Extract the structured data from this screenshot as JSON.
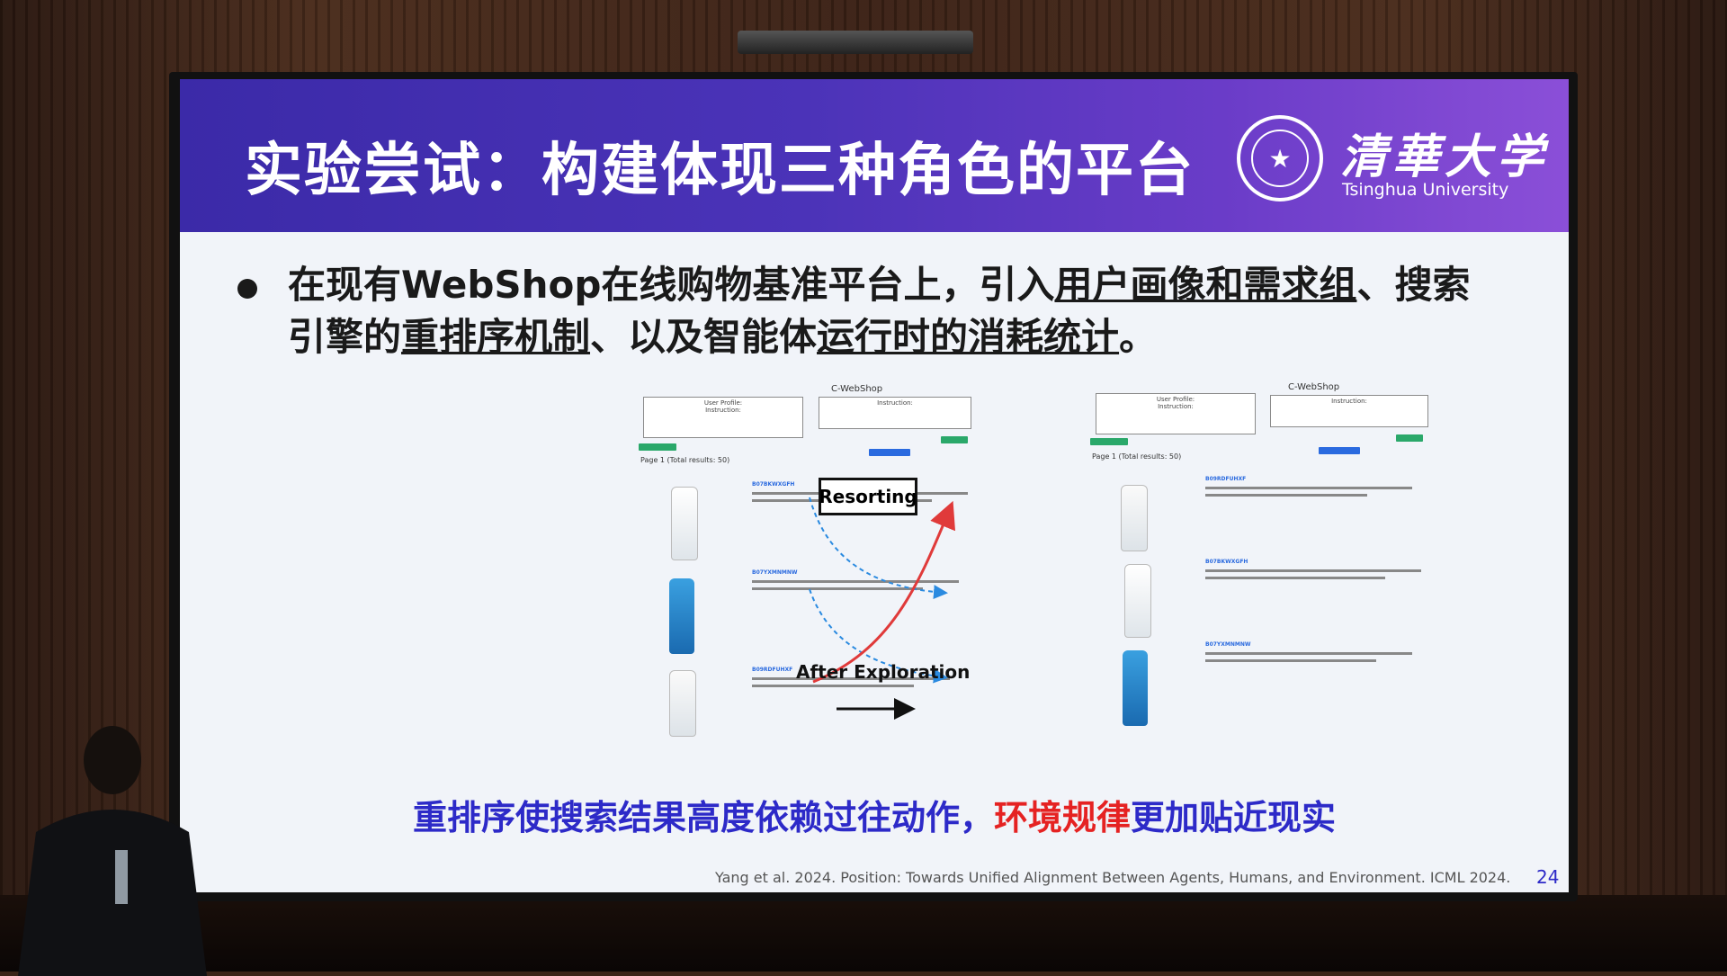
{
  "slide": {
    "title": "实验尝试：构建体现三种角色的平台",
    "logo": {
      "cn": "清華大学",
      "en": "Tsinghua University"
    },
    "bullet": {
      "part1": "在现有WebShop在线购物基准平台上，引入",
      "u1": "用户画像和需求组",
      "part2": "、搜索引擎的",
      "u2": "重排序机制",
      "part3": "、以及智能体",
      "u3": "运行时的消耗统计",
      "part4": "。"
    },
    "figure": {
      "left_title": "C-WebShop",
      "right_title": "C-WebShop",
      "left_page": "Page 1 (Total results: 50)",
      "right_page": "Page 1 (Total results: 50)",
      "resorting": "Resorting",
      "after_exploration": "After Exploration",
      "codes_left": [
        "B07BKWXGFH",
        "B07YXMNMNW",
        "B09RDFUHXF"
      ],
      "codes_right": [
        "B09RDFUHXF",
        "B07BKWXGFH",
        "B07YXMNMNW"
      ],
      "profile_heading": "User Profile:",
      "instruction_heading": "Instruction:"
    },
    "conclusion": {
      "blue1": "重排序使搜索结果高度依赖过往动作，",
      "red": "环境规律",
      "blue2": "更加贴近现实"
    },
    "citation": "Yang et al. 2024. Position: Towards Unified Alignment Between Agents, Humans, and Environment. ICML 2024.",
    "page_number": "24"
  },
  "colors": {
    "title_bar_start": "#3b2aa8",
    "title_bar_end": "#8b4fd8",
    "accent_blue": "#2d2ac8",
    "accent_red": "#e52222"
  }
}
